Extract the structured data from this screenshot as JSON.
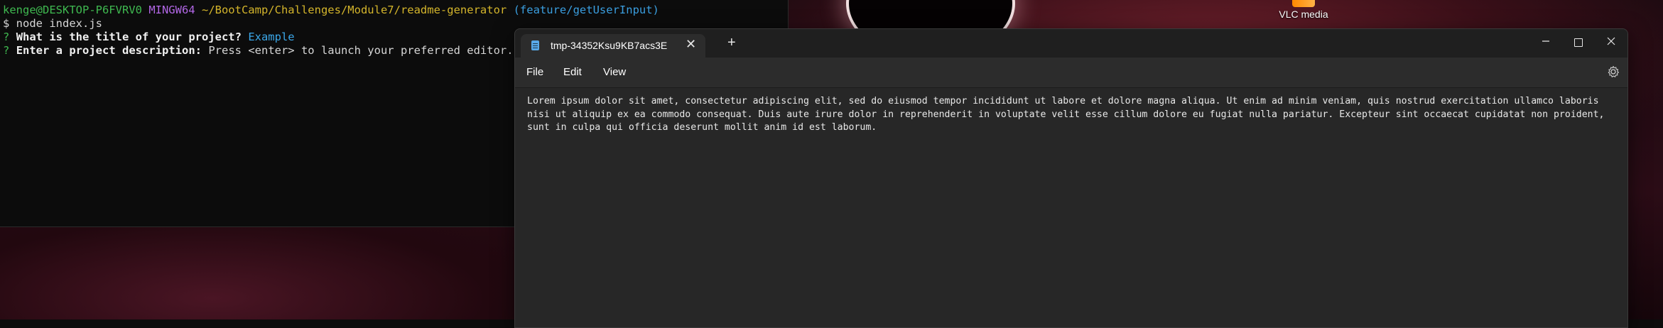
{
  "desktop": {
    "icon_label": "VLC media"
  },
  "terminal": {
    "prompt_user": "kenge@DESKTOP-P6FVRV0",
    "prompt_shell": "MINGW64",
    "prompt_path": "~/BootCamp/Challenges/Module7/readme-generator",
    "prompt_branch": "(feature/getUserInput)",
    "command": "$ node index.js",
    "q1_mark": "?",
    "q1_text": "What is the title of your project?",
    "q1_answer": "Example",
    "q2_mark": "?",
    "q2_text": "Enter a project description:",
    "q2_hint": "Press <enter> to launch your preferred editor."
  },
  "notepad": {
    "tab_title": "tmp-34352Ksu9KB7acs3E",
    "tab_close": "✕",
    "tab_add": "+",
    "menu": {
      "file": "File",
      "edit": "Edit",
      "view": "View"
    },
    "content": "Lorem ipsum dolor sit amet, consectetur adipiscing elit, sed do eiusmod tempor incididunt ut labore et dolore magna aliqua. Ut enim ad minim veniam, quis nostrud exercitation ullamco laboris nisi ut aliquip ex ea commodo consequat. Duis aute irure dolor in reprehenderit in voluptate velit esse cillum dolore eu fugiat nulla pariatur. Excepteur sint occaecat cupidatat non proident, sunt in culpa qui officia deserunt mollit anim id est laborum."
  },
  "icons": {
    "notepad_tab": "notepad-icon",
    "settings": "gear-icon",
    "minimize": "minimize-icon",
    "maximize": "maximize-icon",
    "close": "close-icon"
  }
}
